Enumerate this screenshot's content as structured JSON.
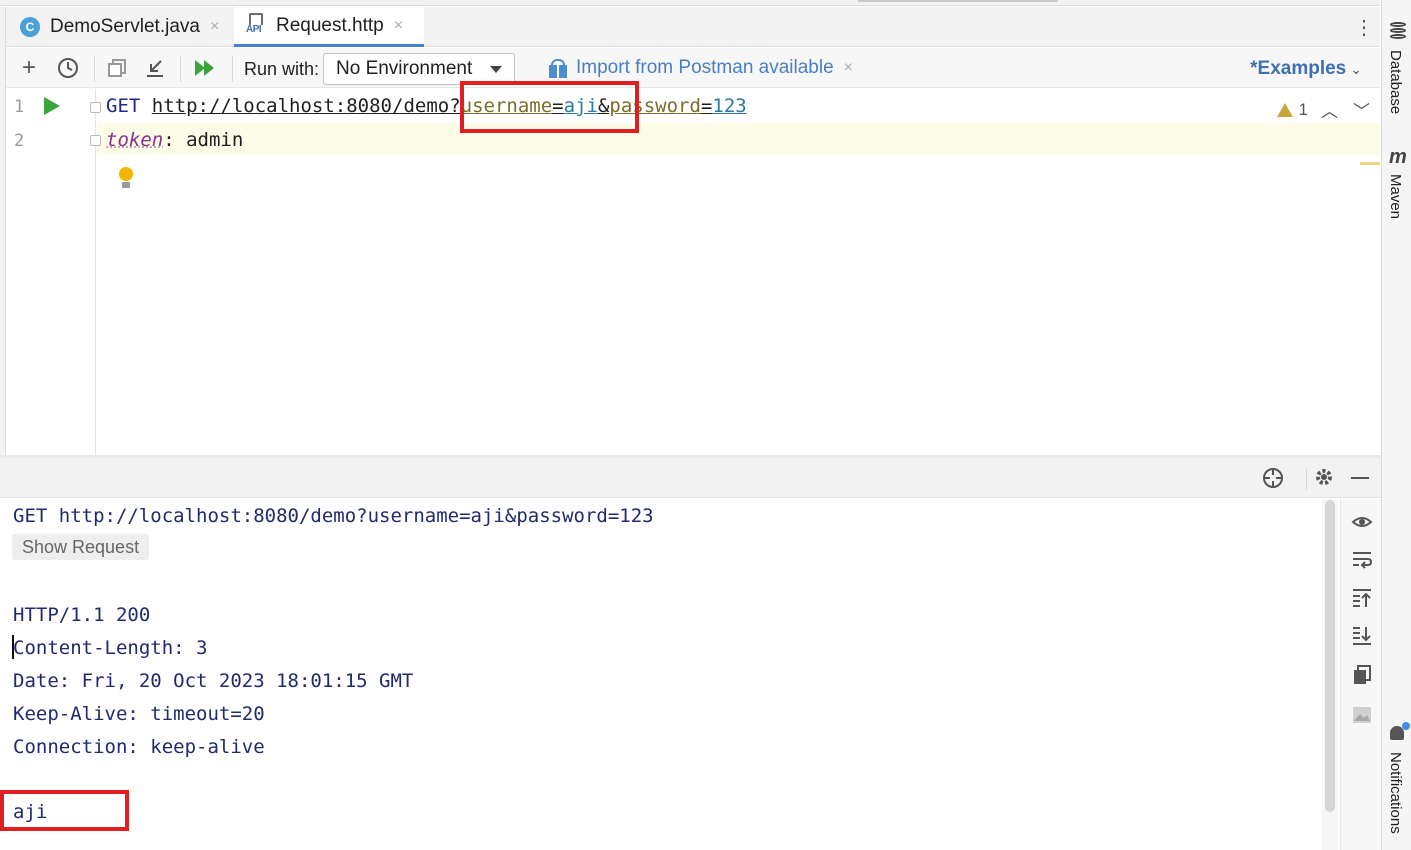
{
  "tabs": [
    {
      "label": "DemoServlet.java",
      "icon": "java-class-icon",
      "icon_letter": "C",
      "close": "×"
    },
    {
      "label": "Request.http",
      "icon": "api-file-icon",
      "icon_text": "API",
      "close": "×"
    }
  ],
  "toolbar": {
    "run_with_label": "Run with:",
    "environment_value": "No Environment",
    "postman_link": "Import from Postman available",
    "postman_close": "×",
    "examples_label": "*Examples",
    "examples_chevron": "⌄"
  },
  "editor": {
    "line_numbers": [
      "1",
      "2"
    ],
    "line1": {
      "method": "GET",
      "url_base": "http://localhost:8080/demo",
      "q": "?",
      "k1": "username",
      "eq1": "=",
      "v1": "aji",
      "amp": "&",
      "k2": "password",
      "eq2": "=",
      "v2": "123"
    },
    "line2": {
      "header_name": "token",
      "colon": ": ",
      "header_value": "admin"
    },
    "warning_count": "1"
  },
  "response": {
    "request_line": "GET http://localhost:8080/demo?username=aji&password=123",
    "show_request": "Show Request",
    "status_line": "HTTP/1.1 200",
    "headers": [
      "Content-Length: 3",
      "Date: Fri, 20 Oct 2023 18:01:15 GMT",
      "Keep-Alive: timeout=20",
      "Connection: keep-alive"
    ],
    "body": "aji"
  },
  "right_strip": {
    "database": "Database",
    "maven": "Maven",
    "notifications": "Notifications"
  },
  "colors": {
    "highlight_box": "#e02020",
    "accent": "#4083c9",
    "run_green": "#3ba53b"
  }
}
